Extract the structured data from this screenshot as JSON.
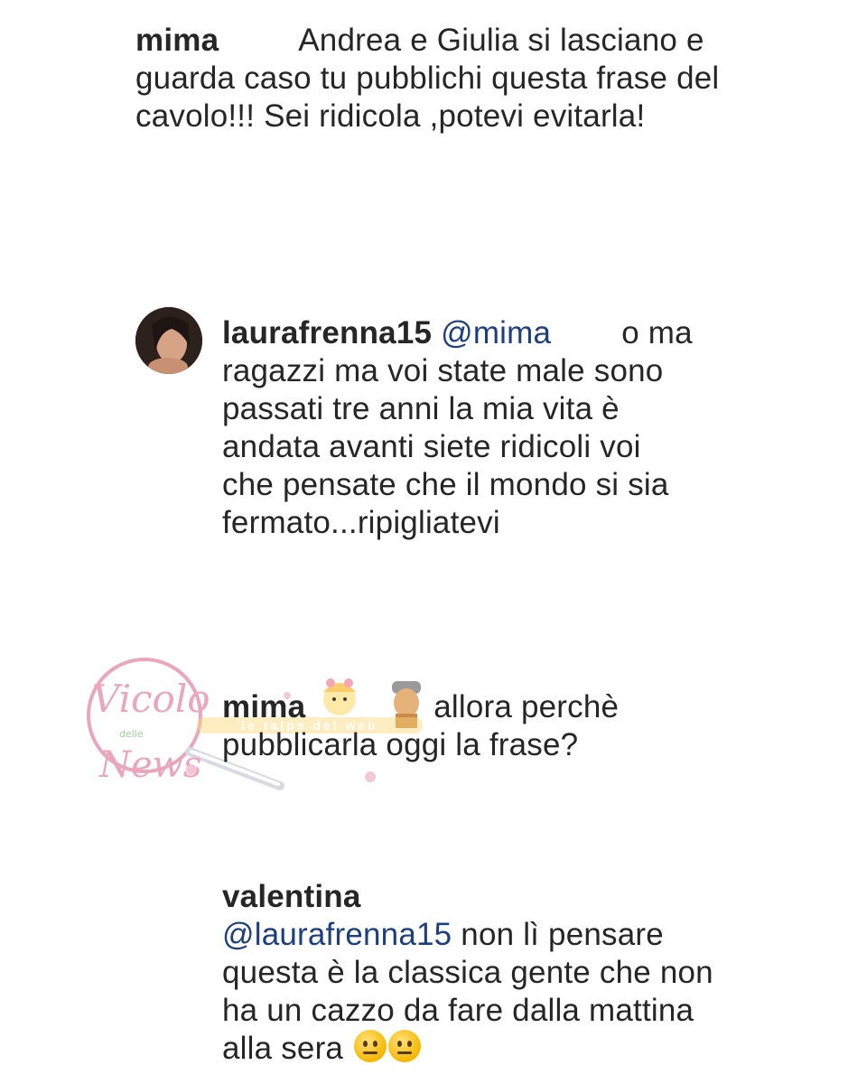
{
  "comments": [
    {
      "username": "mima",
      "text": "Andrea e Giulia si lasciano e guarda caso tu pubblichi questa frase del cavolo!!! Sei ridicola ,potevi evitarla!"
    },
    {
      "username": "laurafrenna15",
      "mention": "@mima",
      "trail": "o",
      "text": "ma ragazzi ma voi state male sono passati tre anni la mia vita è andata avanti siete ridicoli voi che pensate che il mondo si sia fermato...ripigliatevi"
    },
    {
      "username": "mima",
      "text": "allora perchè pubblicarla oggi la frase?"
    },
    {
      "username": "valentina",
      "mention": "@laurafrenna15",
      "text": "non lì pensare questa è la classica gente che non ha un cazzo da fare dalla mattina alla sera",
      "emojis": [
        "neutral-face-emoji",
        "neutral-face-emoji"
      ]
    }
  ],
  "watermark": {
    "brand": "Vicolo delle News",
    "strip_text": "le talpe del web"
  },
  "colors": {
    "text": "#262626",
    "mention": "#1d3f80",
    "watermark_pink": "#e9a6bd"
  }
}
